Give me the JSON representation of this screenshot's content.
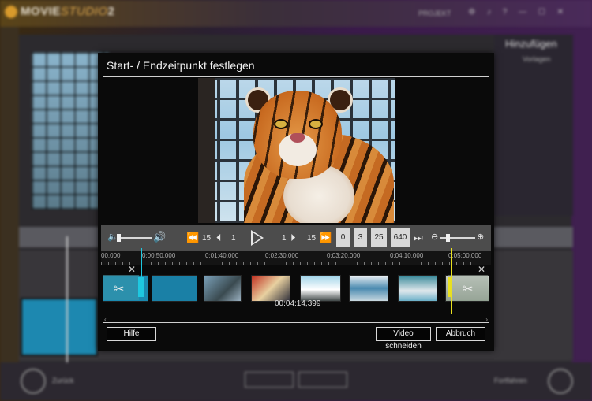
{
  "app": {
    "name": "MOVIE",
    "name_suffix": "STUDIO",
    "version": "2",
    "menu_project": "PROJEKT",
    "panel_title": "Hinzufügen",
    "panel_sub": "Vorlagen",
    "bottom_left": "Zurück",
    "bottom_right": "Fortfahren",
    "btn_a": "Hilfe",
    "btn_b": "Abbruch"
  },
  "dialog": {
    "title": "Start- / Endzeitpunkt festlegen",
    "transport": {
      "skip_back_frames": "15",
      "step_back_frames": "1",
      "step_fwd_frames": "1",
      "skip_fwd_frames": "15",
      "time_fields": [
        "0",
        "3",
        "25",
        "640"
      ]
    },
    "ruler_labels": [
      "00,000",
      "0:00:50,000",
      "0:01:40,000",
      "0:02:30,000",
      "0:03:20,000",
      "0:04:10,000",
      "0:05:00,000"
    ],
    "current_time": "00:04:14,399",
    "buttons": {
      "help": "Hilfe",
      "cut": "Video schneiden",
      "cancel": "Abbruch"
    }
  },
  "colors": {
    "start_marker": "#1ec8e0",
    "end_marker": "#e8e020",
    "dialog_bg": "#0a0a0a",
    "transport_bg": "#4c4c4c"
  },
  "icons": [
    "volume-low-icon",
    "volume-high-icon",
    "rewind-icon",
    "frame-back-icon",
    "play-icon",
    "frame-forward-icon",
    "fast-forward-icon",
    "skip-end-icon",
    "zoom-out-icon",
    "zoom-in-icon",
    "scissors-icon",
    "close-icon"
  ]
}
